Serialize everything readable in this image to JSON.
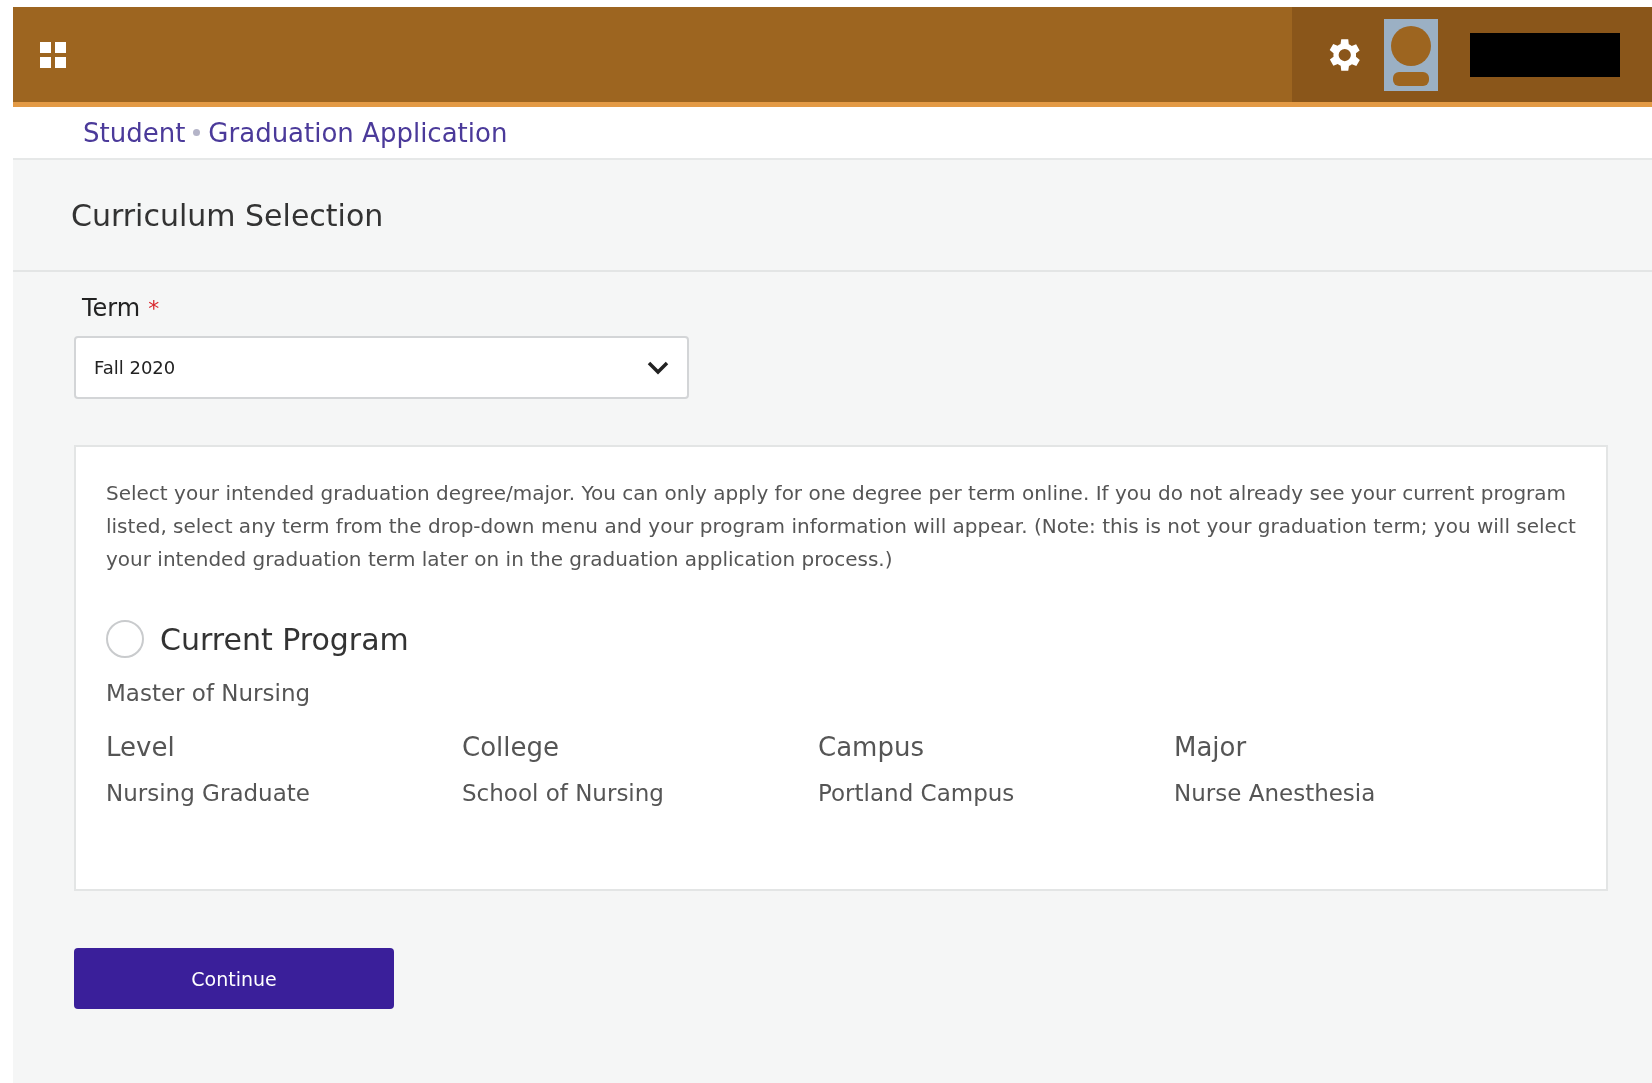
{
  "breadcrumb": [
    "Student",
    "Graduation Application"
  ],
  "section_title": "Curriculum Selection",
  "term": {
    "label": "Term",
    "required": true,
    "required_mark": "*",
    "value": "Fall 2020"
  },
  "instructions": "Select your intended graduation degree/major. You can only apply for one degree per term online. If you do not already see your current program listed, select any term from the drop-down menu and your program information will appear. (Note: this is not your graduation term; you will select your intended graduation term later on in the graduation application process.)",
  "program": {
    "label": "Current Program",
    "selected": false,
    "degree": "Master of Nursing",
    "fields": [
      {
        "label": "Level",
        "value": "Nursing Graduate"
      },
      {
        "label": "College",
        "value": "School of Nursing"
      },
      {
        "label": "Campus",
        "value": "Portland Campus"
      },
      {
        "label": "Major",
        "value": "Nurse Anesthesia"
      }
    ]
  },
  "continue_button": "Continue"
}
